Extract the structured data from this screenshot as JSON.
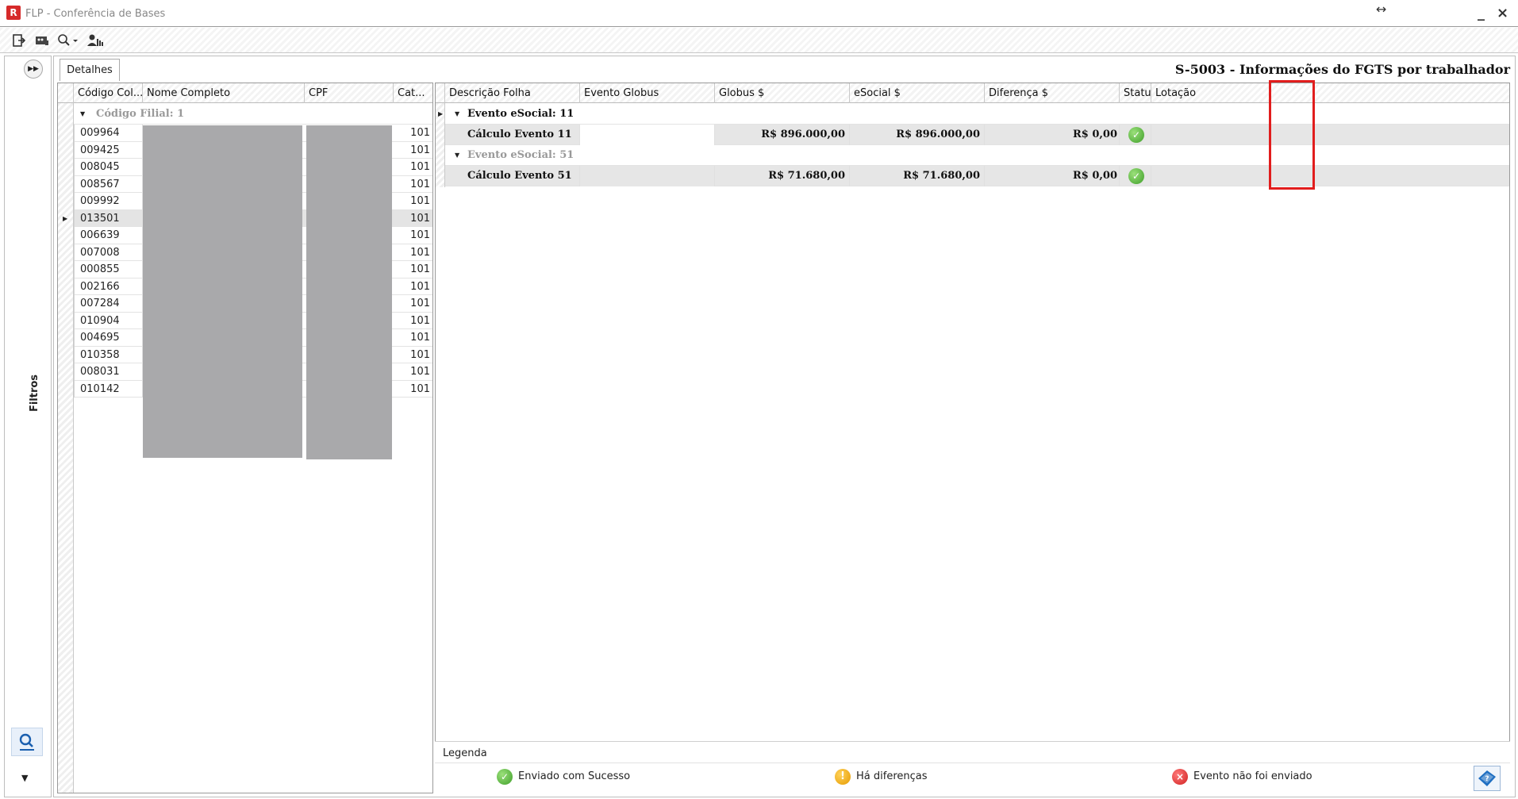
{
  "window": {
    "logo": "R",
    "title": "FLP - Conferência de Bases"
  },
  "toolbar": {
    "icons": [
      "exit-icon",
      "image-icon",
      "search-dropdown-icon",
      "users-icon"
    ]
  },
  "sidebar": {
    "label": "Filtros"
  },
  "tab": {
    "label": "Detalhes"
  },
  "screen_title": "S-5003 - Informações do FGTS por trabalhador",
  "left_grid": {
    "columns": [
      "Código Col...",
      "Nome Completo",
      "CPF",
      "Cat..."
    ],
    "group_label": "Código Filial: 1",
    "rows": [
      {
        "codigo": "009964",
        "cat": "101"
      },
      {
        "codigo": "009425",
        "cat": "101"
      },
      {
        "codigo": "008045",
        "cat": "101"
      },
      {
        "codigo": "008567",
        "cat": "101"
      },
      {
        "codigo": "009992",
        "cat": "101"
      },
      {
        "codigo": "013501",
        "cat": "101"
      },
      {
        "codigo": "006639",
        "cat": "101"
      },
      {
        "codigo": "007008",
        "cat": "101"
      },
      {
        "codigo": "000855",
        "cat": "101"
      },
      {
        "codigo": "002166",
        "cat": "101"
      },
      {
        "codigo": "007284",
        "cat": "101"
      },
      {
        "codigo": "010904",
        "cat": "101"
      },
      {
        "codigo": "004695",
        "cat": "101"
      },
      {
        "codigo": "010358",
        "cat": "101"
      },
      {
        "codigo": "008031",
        "cat": "101"
      },
      {
        "codigo": "010142",
        "cat": "101"
      }
    ],
    "selected_index": 5
  },
  "right_grid": {
    "columns": [
      "Descrição Folha",
      "Evento Globus",
      "Globus $",
      "eSocial $",
      "Diferença $",
      "Status",
      "Lotação"
    ],
    "groups": [
      {
        "label": "Evento eSocial: 11",
        "row": {
          "descricao": "Cálculo Evento 11",
          "evento_globus": "",
          "globus": "R$ 896.000,00",
          "esocial": "R$ 896.000,00",
          "diferenca": "R$ 0,00",
          "status": "ok"
        }
      },
      {
        "label": "Evento eSocial: 51",
        "row": {
          "descricao": "Cálculo Evento 51",
          "evento_globus": "",
          "globus": "R$ 71.680,00",
          "esocial": "R$ 71.680,00",
          "diferenca": "R$ 0,00",
          "status": "ok"
        }
      }
    ]
  },
  "legend": {
    "title": "Legenda",
    "items": [
      {
        "label": "Enviado com Sucesso",
        "icon": "check-icon"
      },
      {
        "label": "Há diferenças",
        "icon": "warning-icon"
      },
      {
        "label": "Evento não foi enviado",
        "icon": "error-icon"
      }
    ]
  },
  "colors": {
    "highlight": "#e11d1d",
    "masked": "#a9a9ab",
    "success": "#3f9f2a",
    "warning": "#e59a00",
    "error": "#d01f1f"
  }
}
